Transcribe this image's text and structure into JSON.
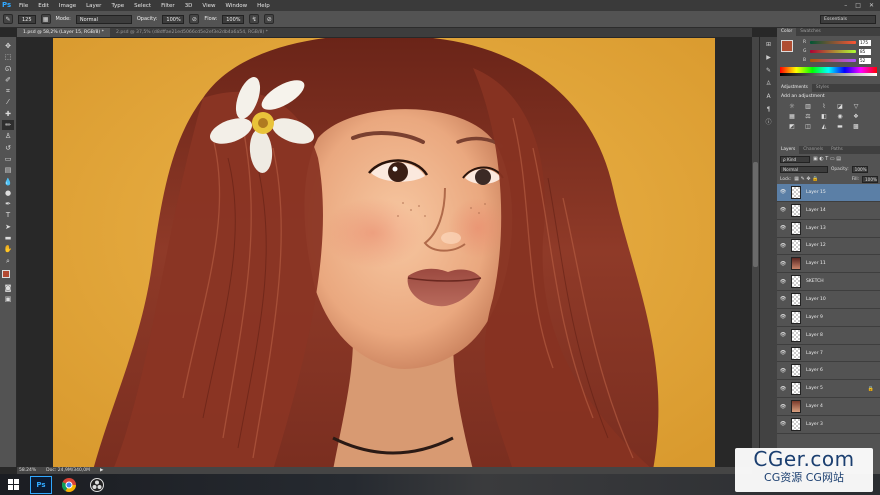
{
  "app": {
    "logo": "Ps"
  },
  "menu": [
    "File",
    "Edit",
    "Image",
    "Layer",
    "Type",
    "Select",
    "Filter",
    "3D",
    "View",
    "Window",
    "Help"
  ],
  "window_controls": [
    "–",
    "□",
    "✕"
  ],
  "options_bar": {
    "brush_size": "125",
    "mode_label": "Mode:",
    "mode_value": "Normal",
    "opacity_label": "Opacity:",
    "opacity_value": "100%",
    "flow_label": "Flow:",
    "flow_value": "100%",
    "workspace": "Essentials"
  },
  "tabs": [
    {
      "label": "1.psd @ 58,2% (Layer 15, RGB/8) *",
      "active": true
    },
    {
      "label": "2.psd @ 37,5% (d8dffae21ed5066cd5e2ef3e2db4a6a54, RGB/8) *",
      "active": false
    }
  ],
  "status": {
    "zoom": "58.24%",
    "doc": "Doc: 24,9M/340,0M"
  },
  "panels": {
    "color_tabs": [
      "Color",
      "Swatches"
    ],
    "color_sliders": [
      {
        "label": "R",
        "value": "175",
        "color": "#d9534f"
      },
      {
        "label": "G",
        "value": "85",
        "color": "#5cb85c"
      },
      {
        "label": "B",
        "value": "52",
        "color": "#5b7fd8"
      }
    ],
    "fg_color": "#b04e32",
    "adjust_tabs": [
      "Adjustments",
      "Styles"
    ],
    "add_adjustment": "Add an adjustment",
    "layers_tabs": [
      "Layers",
      "Channels",
      "Paths"
    ],
    "kind_label": "ρ Kind",
    "blend_mode": "Normal",
    "opacity_label": "Opacity:",
    "opacity_value": "100%",
    "lock_label": "Lock:",
    "fill_label": "Fill:",
    "fill_value": "100%",
    "layers": [
      {
        "name": "Layer 15",
        "selected": true,
        "thumb": "blank",
        "locked": false
      },
      {
        "name": "Layer 14",
        "selected": false,
        "thumb": "blank",
        "locked": false
      },
      {
        "name": "Layer 13",
        "selected": false,
        "thumb": "blank",
        "locked": false
      },
      {
        "name": "Layer 12",
        "selected": false,
        "thumb": "blank",
        "locked": false
      },
      {
        "name": "Layer 11",
        "selected": false,
        "thumb": "dot",
        "locked": false
      },
      {
        "name": "SKETCH",
        "selected": false,
        "thumb": "blank",
        "locked": false
      },
      {
        "name": "Layer 10",
        "selected": false,
        "thumb": "blank",
        "locked": false
      },
      {
        "name": "Layer 9",
        "selected": false,
        "thumb": "blank",
        "locked": false
      },
      {
        "name": "Layer 8",
        "selected": false,
        "thumb": "blank",
        "locked": false
      },
      {
        "name": "Layer 7",
        "selected": false,
        "thumb": "blank",
        "locked": false
      },
      {
        "name": "Layer 6",
        "selected": false,
        "thumb": "blank",
        "locked": false
      },
      {
        "name": "Layer 5",
        "selected": false,
        "thumb": "blank",
        "locked": true
      },
      {
        "name": "Layer 4",
        "selected": false,
        "thumb": "img",
        "locked": false
      },
      {
        "name": "Layer 3",
        "selected": false,
        "thumb": "blank",
        "locked": false
      }
    ]
  },
  "watermark": {
    "line1": "CGer.com",
    "line2": "CG资源 CG网站"
  },
  "taskbar": {
    "ps": "Ps"
  },
  "tool_icons": [
    "move-icon",
    "marquee-icon",
    "lasso-icon",
    "quick-select-icon",
    "crop-icon",
    "eyedropper-icon",
    "healing-icon",
    "brush-icon",
    "clone-stamp-icon",
    "history-brush-icon",
    "eraser-icon",
    "gradient-icon",
    "blur-icon",
    "dodge-icon",
    "pen-icon",
    "type-icon",
    "path-select-icon",
    "shape-icon",
    "hand-icon",
    "zoom-icon"
  ]
}
